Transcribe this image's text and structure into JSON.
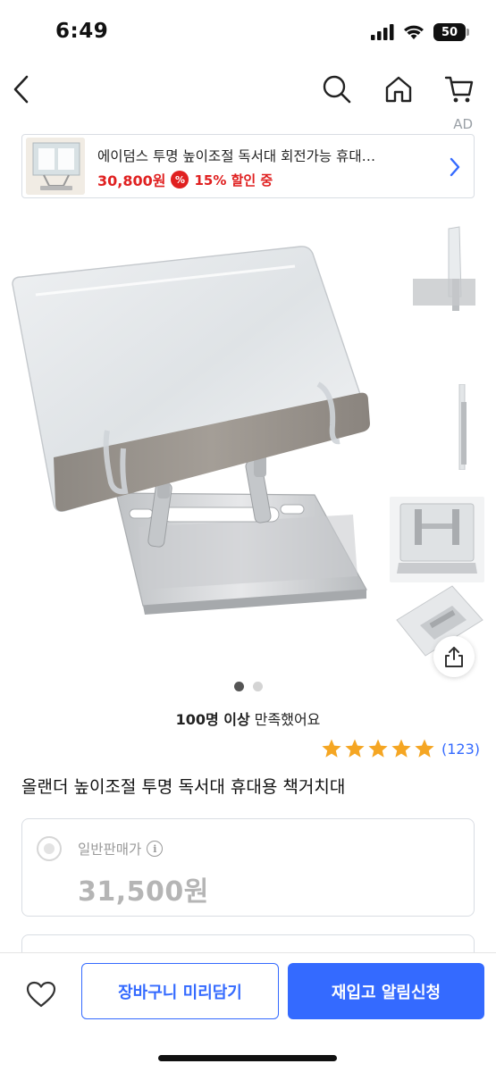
{
  "status": {
    "time": "6:49",
    "battery": "50"
  },
  "nav": {
    "back_icon": "chevron-left-icon",
    "search_icon": "search-icon",
    "home_icon": "home-icon",
    "cart_icon": "cart-icon"
  },
  "ad": {
    "label": "AD",
    "title": "에이덤스 투명 높이조절 독서대 회전가능 휴대…",
    "price": "30,800원",
    "badge": "%",
    "discount": "15% 할인 중"
  },
  "gallery": {
    "dots": 2,
    "active_dot": 1
  },
  "satisfaction": {
    "bold": "100명 이상",
    "rest": " 만족했어요"
  },
  "rating": {
    "stars": 5,
    "count": "(123)",
    "star_color": "#f5a623"
  },
  "product": {
    "title": "올랜더 높이조절 투명 독서대 휴대용 책거치대"
  },
  "option": {
    "label": "일반판매가",
    "price": "31,500원"
  },
  "bottom": {
    "cart_label": "장바구니 미리담기",
    "notify_label": "재입고 알림신청"
  },
  "colors": {
    "accent": "#346aff",
    "sale": "#e02020"
  }
}
